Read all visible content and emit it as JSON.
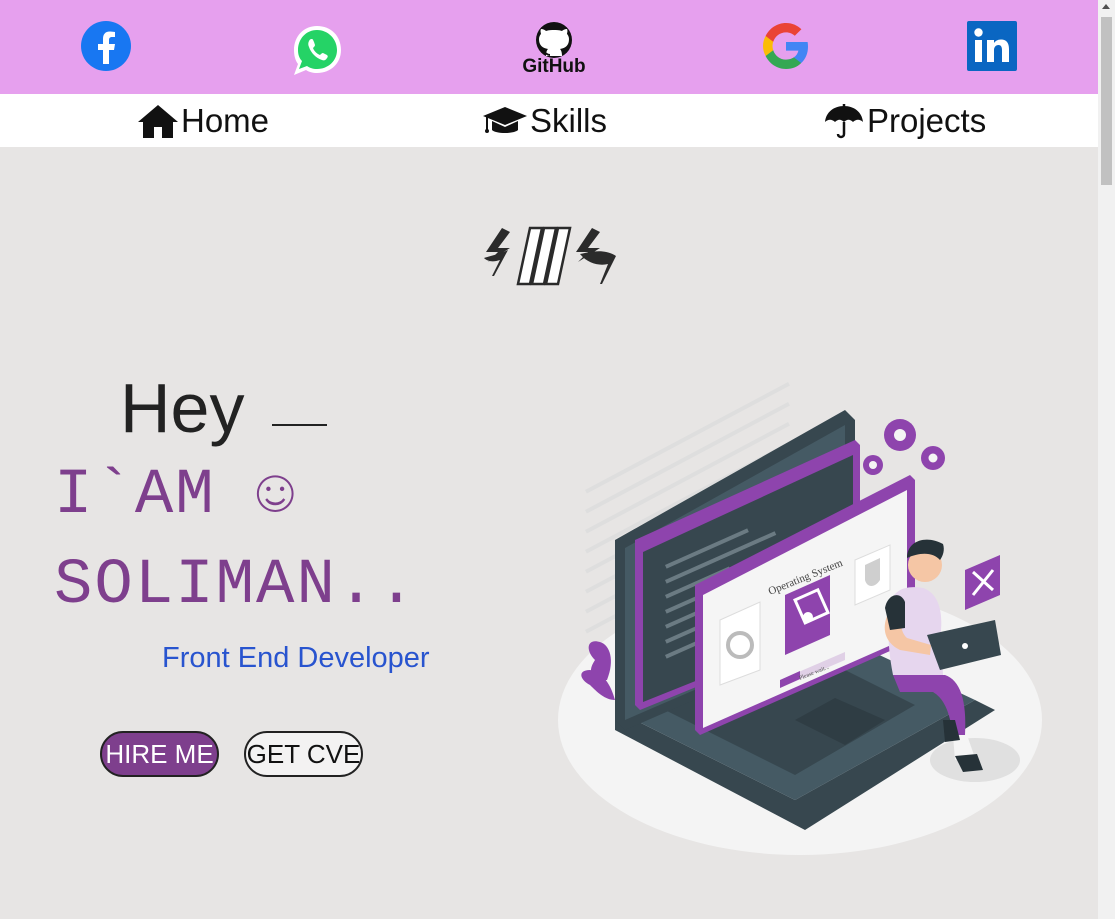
{
  "social": [
    {
      "name": "facebook",
      "icon": "facebook-icon",
      "color": "#1877f2"
    },
    {
      "name": "whatsapp",
      "icon": "whatsapp-icon",
      "color": "#25d366"
    },
    {
      "name": "github",
      "icon": "github-icon",
      "label": "GitHub",
      "color": "#111111"
    },
    {
      "name": "google",
      "icon": "google-icon",
      "color": "#4285f4"
    },
    {
      "name": "linkedin",
      "icon": "linkedin-icon",
      "color": "#0a66c2",
      "label": "in"
    }
  ],
  "nav": {
    "home": {
      "label": "Home",
      "icon": "home-icon"
    },
    "skills": {
      "label": "Skills",
      "icon": "graduation-cap-icon"
    },
    "projects": {
      "label": "Projects",
      "icon": "umbrella-icon"
    }
  },
  "hero": {
    "greeting": "Hey",
    "line1": "I`AM ☺",
    "line2": "SOLIMAN..",
    "role": "Front End Developer",
    "hire_label": "HIRE ME",
    "cv_label": "GET CVE"
  },
  "illustration": {
    "window_title": "Operating System",
    "status_text": "Please wait..."
  },
  "colors": {
    "header_bg": "#e6a0ee",
    "accent": "#7e3f8d",
    "role_text": "#2854cf",
    "page_bg": "#e7e5e4"
  }
}
